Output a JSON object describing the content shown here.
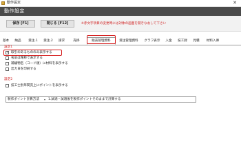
{
  "window": {
    "title": "動作設定",
    "close_glyph": "✕"
  },
  "header": {
    "title": "動作設定"
  },
  "toolbar": {
    "save_label": "保存 [F1]",
    "close_label": "閉じる [F12]",
    "notice": "※赤文字項目の変更時には対象の画面を開きなおして下さい"
  },
  "tabs": [
    "基本",
    "納品",
    "受注.1",
    "受注.2",
    "請求",
    "売掛",
    "販売管理資料",
    "受注管理資料",
    "グラフ表示",
    "入金",
    "技工録",
    "見積",
    "材料入庫"
  ],
  "active_tab": "販売管理資料",
  "settings": {
    "section1_title": "設定1",
    "options": [
      {
        "label": "取引のあるもののみ表示する",
        "checked": true
      },
      {
        "label": "名前は略称で表示する",
        "checked": false
      },
      {
        "label": "補綴物名（コード順）に材料を表示する",
        "checked": false
      },
      {
        "label": "出力日を印刷する",
        "checked": false
      }
    ],
    "section2_title": "設定2",
    "options2": [
      {
        "label": "技工士別年間売上にポイントを表示する",
        "checked": false
      }
    ],
    "calc_label": "製作ポイント計算方法",
    "calc_value": "1.試適・試適後を製作ポイントそのままで計算する"
  }
}
